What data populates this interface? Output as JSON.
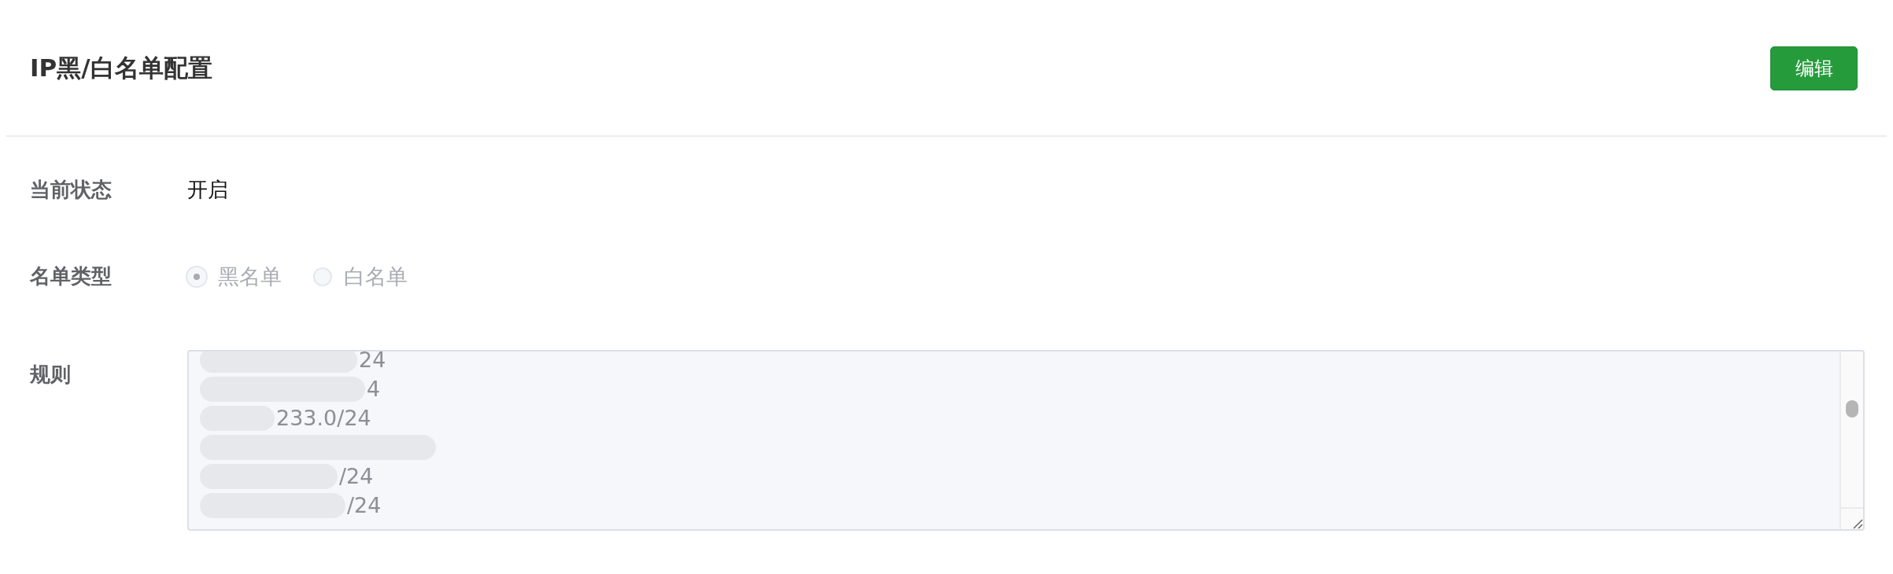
{
  "header": {
    "title": "IP黑/白名单配置",
    "edit_button": "编辑"
  },
  "fields": [
    {
      "kind": "text",
      "label": "当前状态",
      "value": "开启"
    },
    {
      "kind": "radio",
      "label": "名单类型",
      "disabled": true,
      "options": [
        {
          "label": "黑名单",
          "selected": true
        },
        {
          "label": "白名单",
          "selected": false
        }
      ]
    },
    {
      "kind": "textarea",
      "label": "规则",
      "lines": [
        {
          "kind": "text",
          "text": "24"
        },
        {
          "kind": "text",
          "text": "4"
        },
        {
          "kind": "text",
          "text": "233.0/24"
        },
        {
          "kind": "blurred"
        },
        {
          "kind": "text",
          "text": "/24"
        },
        {
          "kind": "text",
          "text": "/24"
        }
      ]
    }
  ]
}
